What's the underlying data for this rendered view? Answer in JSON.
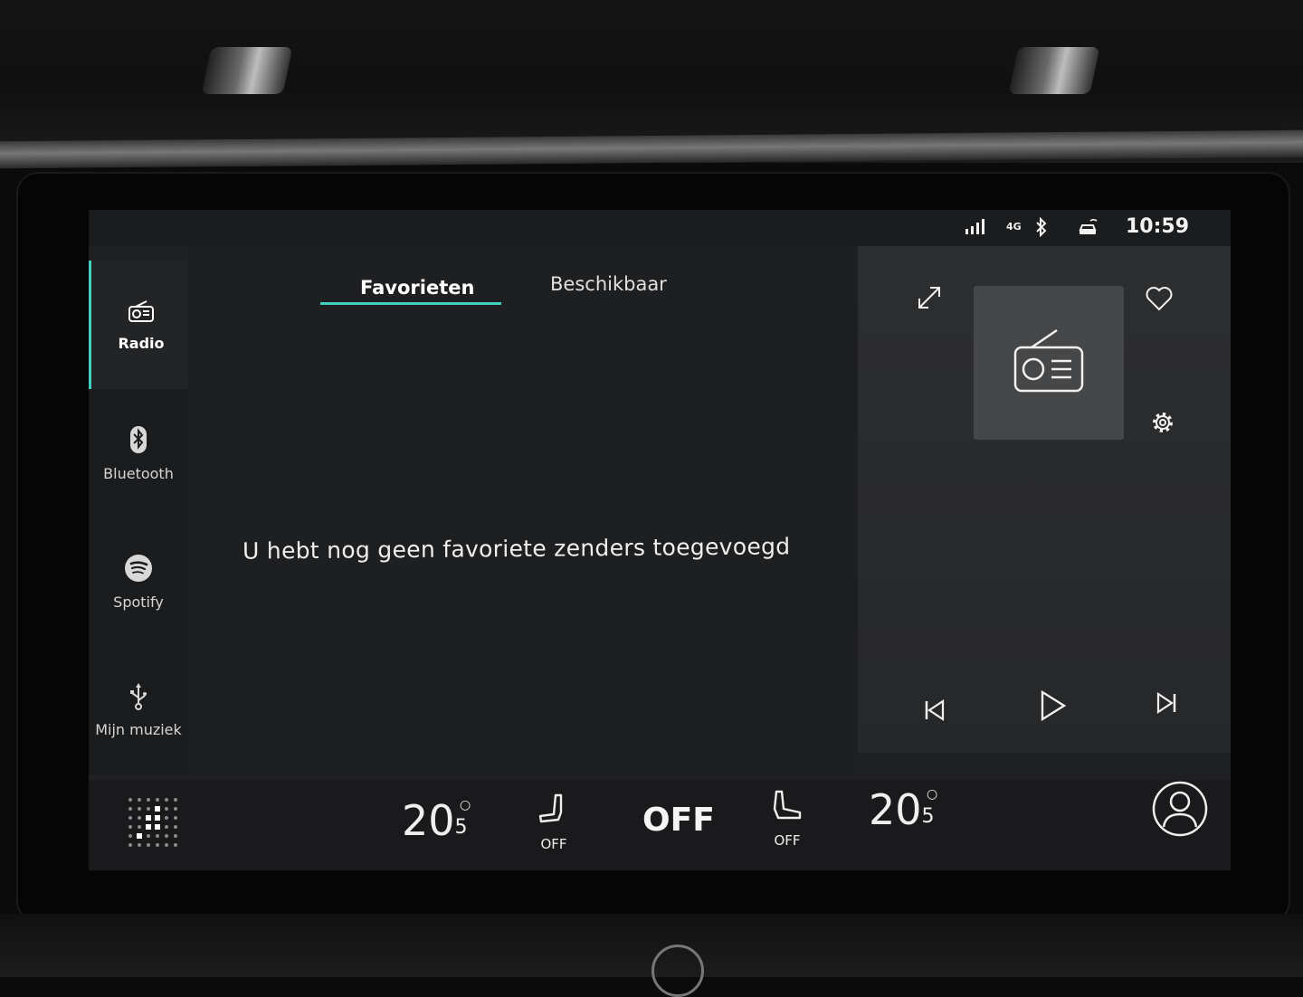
{
  "status": {
    "network": "4G",
    "time": "10:59"
  },
  "sidebar": {
    "items": [
      {
        "label": "Radio",
        "icon": "radio-icon",
        "active": true
      },
      {
        "label": "Bluetooth",
        "icon": "bluetooth-icon",
        "active": false
      },
      {
        "label": "Spotify",
        "icon": "spotify-icon",
        "active": false
      },
      {
        "label": "Mijn muziek",
        "icon": "usb-icon",
        "active": false
      }
    ]
  },
  "tabs": [
    {
      "label": "Favorieten",
      "active": true
    },
    {
      "label": "Beschikbaar",
      "active": false
    }
  ],
  "main": {
    "empty_message": "U hebt nog geen favoriete zenders toegevoegd"
  },
  "climate": {
    "left_temp_whole": "20",
    "left_temp_decimal": "5",
    "left_seat_label": "OFF",
    "fan_label": "OFF",
    "right_seat_label": "OFF",
    "right_temp_whole": "20",
    "right_temp_decimal": "5"
  },
  "colors": {
    "accent": "#3fd0c0",
    "screen_bg": "#1f2022",
    "player_bg": "#2d2e30"
  }
}
